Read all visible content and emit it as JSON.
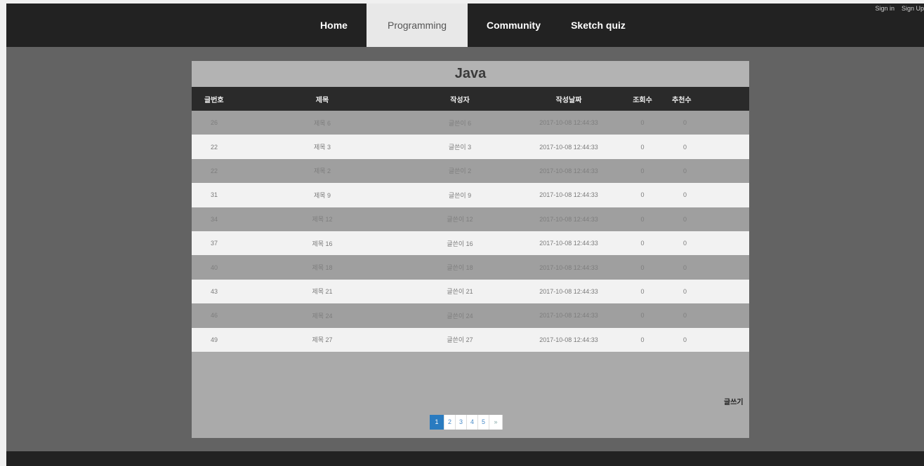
{
  "nav": {
    "items": [
      {
        "label": "Home"
      },
      {
        "label": "Programming"
      },
      {
        "label": "Community"
      },
      {
        "label": "Sketch quiz"
      }
    ],
    "active_index": 1
  },
  "auth": {
    "sign_in": "Sign in",
    "sign_up": "Sign Up"
  },
  "board": {
    "title": "Java",
    "columns": [
      "글번호",
      "제목",
      "작성자",
      "작성날짜",
      "조회수",
      "추천수"
    ],
    "rows": [
      [
        "26",
        "제목 6",
        "글쓴이 6",
        "2017-10-08 12:44:33",
        "0",
        "0"
      ],
      [
        "22",
        "제목 3",
        "글쓴이 3",
        "2017-10-08 12:44:33",
        "0",
        "0"
      ],
      [
        "22",
        "제목 2",
        "글쓴이 2",
        "2017-10-08 12:44:33",
        "0",
        "0"
      ],
      [
        "31",
        "제목 9",
        "글쓴이 9",
        "2017-10-08 12:44:33",
        "0",
        "0"
      ],
      [
        "34",
        "제목 12",
        "글쓴이 12",
        "2017-10-08 12:44:33",
        "0",
        "0"
      ],
      [
        "37",
        "제목 16",
        "글쓴이 16",
        "2017-10-08 12:44:33",
        "0",
        "0"
      ],
      [
        "40",
        "제목 18",
        "글쓴이 18",
        "2017-10-08 12:44:33",
        "0",
        "0"
      ],
      [
        "43",
        "제목 21",
        "글쓴이 21",
        "2017-10-08 12:44:33",
        "0",
        "0"
      ],
      [
        "46",
        "제목 24",
        "글쓴이 24",
        "2017-10-08 12:44:33",
        "0",
        "0"
      ],
      [
        "49",
        "제목 27",
        "글쓴이 27",
        "2017-10-08 12:44:33",
        "0",
        "0"
      ]
    ],
    "write_label": "글쓰기"
  },
  "pagination": {
    "pages": [
      "1",
      "2",
      "3",
      "4",
      "5"
    ],
    "next": "»",
    "current": "1"
  },
  "colors": {
    "background": "#636363",
    "topbar": "#222222",
    "panel": "#aaaaaa",
    "header_row": "#2a2a2a",
    "accent": "#2a7bc0"
  }
}
